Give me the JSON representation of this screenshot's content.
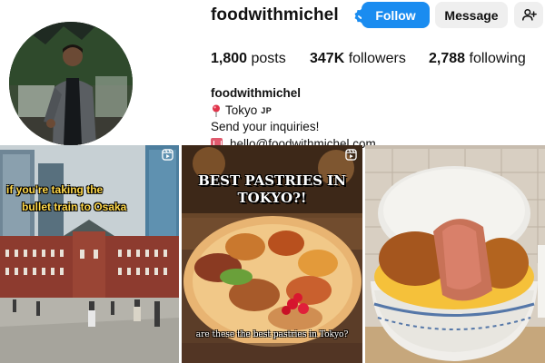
{
  "profile": {
    "username": "foodwithmichel",
    "verified_icon": "verified-badge-icon",
    "buttons": {
      "follow_label": "Follow",
      "message_label": "Message",
      "add_user_icon": "add-user-icon"
    },
    "stats": {
      "posts_count": "1,800",
      "posts_label": "posts",
      "followers_count": "347K",
      "followers_label": "followers",
      "following_count": "2,788",
      "following_label": "following"
    },
    "bio": {
      "name": "foodwithmichel",
      "location": "Tokyo",
      "location_suffix": "JP",
      "line": "Send your inquiries!",
      "email": "hello@foodwithmichel.com"
    }
  },
  "grid": {
    "posts": [
      {
        "type": "reel",
        "caption_line1": "if you're taking the",
        "caption_line2": "bullet train to Osaka"
      },
      {
        "type": "reel",
        "caption_title": "BEST PASTRIES IN TOKYO?!",
        "caption_sub": "are these the best pastries in Tokyo?"
      },
      {
        "type": "post"
      }
    ]
  },
  "colors": {
    "accent": "#1a8cf0",
    "button_secondary": "#efefef",
    "caption_yellow": "#ffd84a"
  }
}
